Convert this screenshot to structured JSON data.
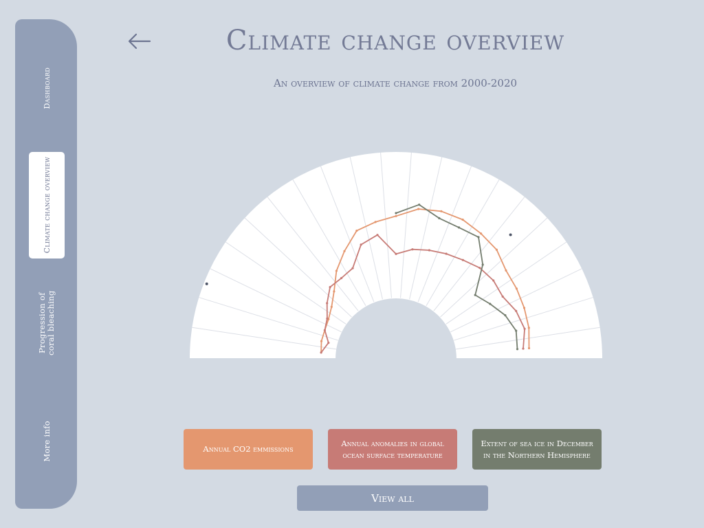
{
  "sidebar": {
    "items": [
      {
        "label": "Dashboard"
      },
      {
        "label": "Climate change overview"
      },
      {
        "label": "Progression of coral bleaching"
      },
      {
        "label": "More info"
      }
    ]
  },
  "header": {
    "title": "Climate change overview",
    "subtitle": "An overview of climate change from 2000-2020",
    "back_icon": "arrow-left-icon"
  },
  "legend": {
    "co2": {
      "label": "Annual CO2 emmissions",
      "color": "#e4976f"
    },
    "ocean": {
      "label": "Annual anomalies in global ocean surface temperature",
      "color": "#c77b76"
    },
    "ice": {
      "label": "Extent of sea ice in December in the Northern Hemisphere",
      "color": "#747d6e"
    }
  },
  "actions": {
    "view_all": "View all"
  },
  "chart_data": {
    "type": "line",
    "series": [
      {
        "name": "Annual CO2 emmissions",
        "color": "#e4976f",
        "values": [
          0.1,
          0.11,
          0.11,
          0.12,
          0.15,
          0.21,
          0.31,
          0.4,
          0.5,
          0.53,
          0.56,
          0.62,
          0.64,
          0.64,
          0.62,
          0.6,
          0.55,
          0.54,
          0.53,
          0.52,
          0.5
        ]
      },
      {
        "name": "Annual anomalies in global ocean surface temperature",
        "color": "#c77b76",
        "values": [
          0.1,
          0.06,
          0.11,
          0.13,
          0.19,
          0.25,
          0.25,
          0.27,
          0.4,
          0.44,
          0.3,
          0.34,
          0.36,
          0.38,
          0.4,
          0.43,
          0.44,
          0.43,
          0.47,
          0.49,
          0.46
        ]
      },
      {
        "name": "Extent of sea ice in December in the Northern Hemisphere",
        "color": "#747d6e",
        "start_index": 10,
        "values": [
          0.58,
          0.65,
          0.59,
          0.58,
          0.59,
          0.46,
          0.28,
          0.33,
          0.39,
          0.43,
          0.42
        ]
      }
    ],
    "extra_points": [
      [
        2,
        0.98
      ],
      [
        15,
        0.74
      ]
    ],
    "count": 21,
    "grid": true
  }
}
